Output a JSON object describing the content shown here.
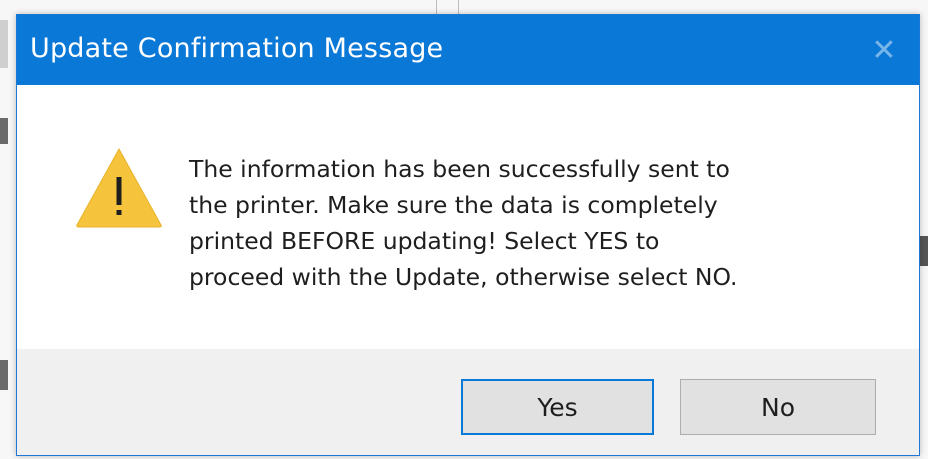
{
  "dialog": {
    "title": "Update Confirmation Message",
    "close_glyph": "✕",
    "icon": "warning-icon",
    "message_lines": [
      "The information has been successfully sent to",
      "the printer.  Make sure the data is completely",
      "printed BEFORE updating!  Select YES to",
      "proceed with the Update, otherwise select NO."
    ],
    "buttons": {
      "yes_label": "Yes",
      "no_label": "No"
    }
  },
  "colors": {
    "titlebar": "#0a78d7",
    "warning_fill": "#f5c43c",
    "warning_glyph": "#1e1e1e"
  }
}
